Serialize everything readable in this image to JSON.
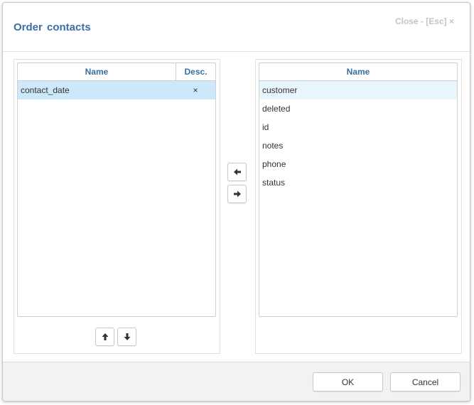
{
  "dialog": {
    "title": "Order contacts",
    "close_label": "Close - [Esc] ×"
  },
  "order_grid": {
    "columns": {
      "name": "Name",
      "desc": "Desc."
    },
    "rows": [
      {
        "name": "contact_date",
        "desc": "×"
      }
    ]
  },
  "available_grid": {
    "columns": {
      "name": "Name"
    },
    "rows": [
      {
        "name": "customer"
      },
      {
        "name": "deleted"
      },
      {
        "name": "id"
      },
      {
        "name": "notes"
      },
      {
        "name": "phone"
      },
      {
        "name": "status"
      }
    ]
  },
  "icons": {
    "move_left": "arrow-left-icon",
    "move_right": "arrow-right-icon",
    "move_up": "arrow-up-icon",
    "move_down": "arrow-down-icon"
  },
  "footer": {
    "ok_label": "OK",
    "cancel_label": "Cancel"
  },
  "colors": {
    "title": "#3a6ea5",
    "selected_row": "#cde8fb",
    "hover_row": "#e8f5fd"
  }
}
